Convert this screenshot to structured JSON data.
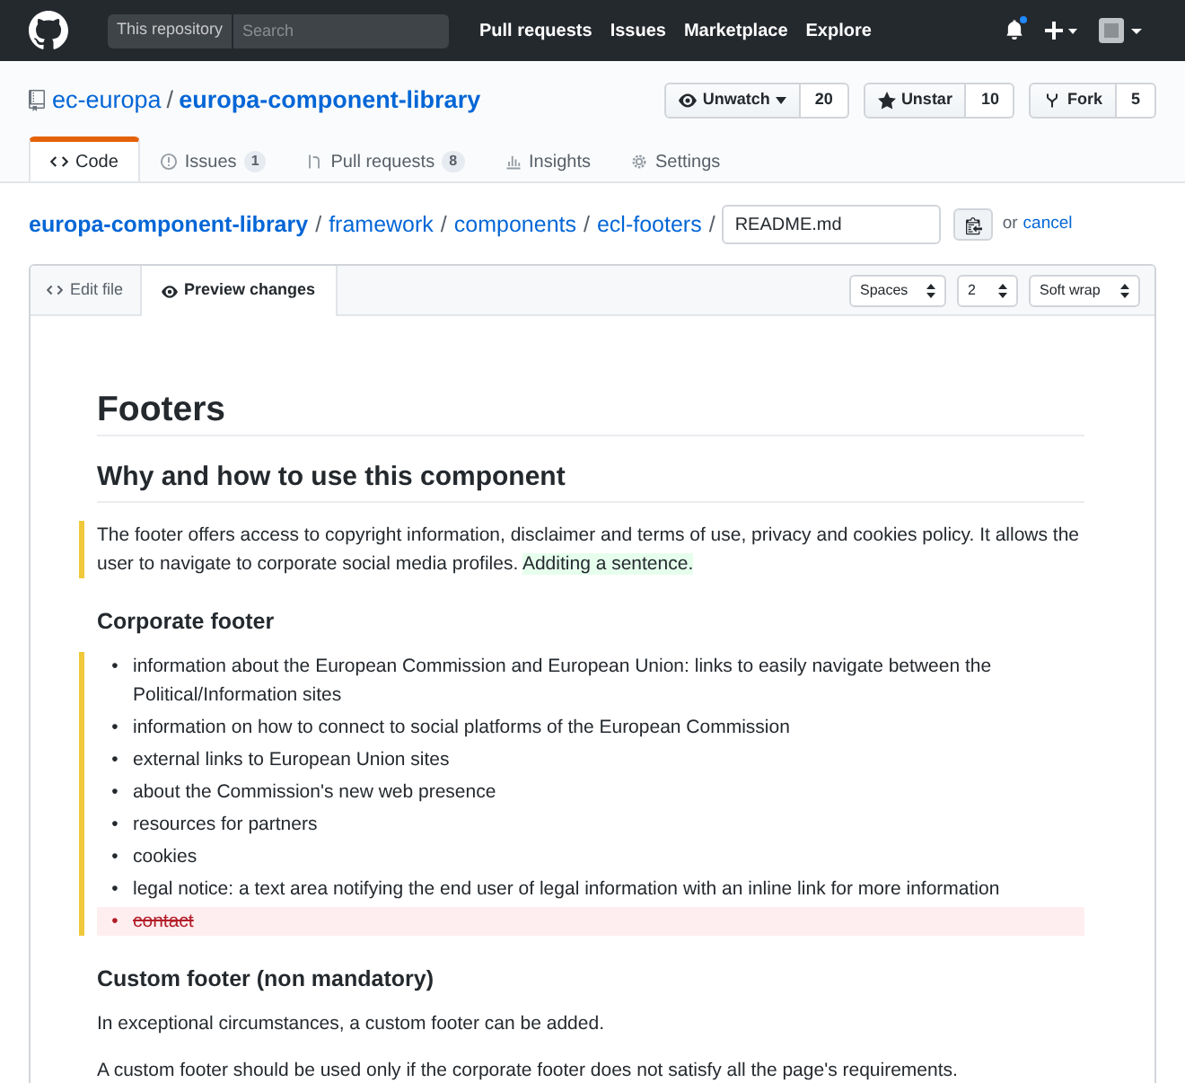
{
  "topbar": {
    "scope": "This repository",
    "search_placeholder": "Search",
    "nav": [
      "Pull requests",
      "Issues",
      "Marketplace",
      "Explore"
    ],
    "notification_unread": true
  },
  "repo": {
    "owner": "ec-europa",
    "separator": "/",
    "name": "europa-component-library",
    "actions": [
      {
        "kind": "watch",
        "label": "Unwatch",
        "count": "20"
      },
      {
        "kind": "star",
        "label": "Unstar",
        "count": "10"
      },
      {
        "kind": "fork",
        "label": "Fork",
        "count": "5"
      }
    ],
    "tabs": [
      {
        "kind": "code",
        "label": "Code",
        "selected": true
      },
      {
        "kind": "issues",
        "label": "Issues",
        "count": "1",
        "selected": false
      },
      {
        "kind": "pulls",
        "label": "Pull requests",
        "count": "8",
        "selected": false
      },
      {
        "kind": "insights",
        "label": "Insights",
        "selected": false
      },
      {
        "kind": "settings",
        "label": "Settings",
        "selected": false
      }
    ]
  },
  "breadcrumb": {
    "root": "europa-component-library",
    "parts": [
      "framework",
      "components",
      "ecl-footers"
    ],
    "separator": "/",
    "filename": "README.md",
    "or": "or",
    "cancel": "cancel"
  },
  "editor": {
    "tabs": [
      {
        "kind": "edit",
        "label": "Edit file",
        "selected": false
      },
      {
        "kind": "preview",
        "label": "Preview changes",
        "selected": true
      }
    ],
    "selects": [
      "Spaces",
      "2",
      "Soft wrap"
    ]
  },
  "preview": [
    {
      "kind": "h1",
      "text": "Footers"
    },
    {
      "kind": "h2",
      "text": "Why and how to use this component"
    },
    {
      "kind": "p",
      "changed": true,
      "text": "The footer offers access to copyright information, disclaimer and terms of use, privacy and cookies policy. It allows the user to navigate to corporate social media profiles.",
      "added": "Additing a sentence."
    },
    {
      "kind": "h3",
      "text": "Corporate footer"
    },
    {
      "kind": "ul",
      "changed": true,
      "marker": "•",
      "items": [
        {
          "text": "information about the European Commission and European Union: links to easily navigate between the Political/Information sites",
          "removed": false
        },
        {
          "text": "information on how to connect to social platforms of the European Commission",
          "removed": false
        },
        {
          "text": "external links to European Union sites",
          "removed": false
        },
        {
          "text": "about the Commission's new web presence",
          "removed": false
        },
        {
          "text": "resources for partners",
          "removed": false
        },
        {
          "text": "cookies",
          "removed": false
        },
        {
          "text": "legal notice: a text area notifying the end user of legal information with an inline link for more information",
          "removed": false
        },
        {
          "text": "contact",
          "removed": true
        }
      ]
    },
    {
      "kind": "h3",
      "text": "Custom footer (non mandatory)"
    },
    {
      "kind": "p",
      "changed": false,
      "text": "In exceptional circumstances, a custom footer can be added."
    },
    {
      "kind": "p",
      "changed": false,
      "text": "A custom footer should be used only if the corporate footer does not satisfy all the page's requirements."
    }
  ]
}
